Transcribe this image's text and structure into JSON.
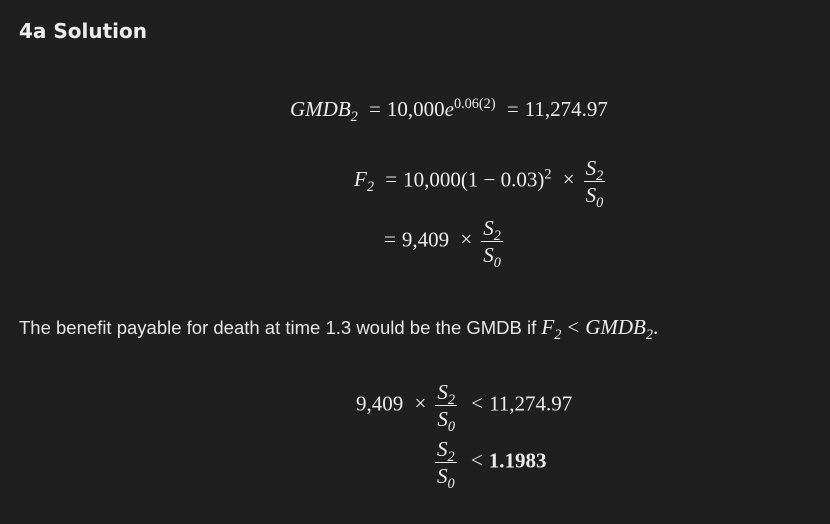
{
  "heading": "4a Solution",
  "equations": {
    "gmdb": {
      "lhs_base": "GMDB",
      "lhs_sub": "2",
      "eq": "=",
      "coef": "10,000",
      "e": "e",
      "exp": "0.06(2)",
      "eq2": "=",
      "result": "11,274.97"
    },
    "f2_line1": {
      "lhs_base": "F",
      "lhs_sub": "2",
      "eq": "=",
      "expr": "10,000(1 − 0.03)",
      "exp": "2",
      "times": "×",
      "frac_num_base": "S",
      "frac_num_sub": "2",
      "frac_den_base": "S",
      "frac_den_sub": "0"
    },
    "f2_line2": {
      "eq": "=",
      "coef": "9,409",
      "times": "×",
      "frac_num_base": "S",
      "frac_num_sub": "2",
      "frac_den_base": "S",
      "frac_den_sub": "0"
    }
  },
  "paragraph": {
    "text": "The benefit payable for death at time 1.3 would be the GMDB if ",
    "math_f": "F",
    "math_f_sub": "2",
    "lt": "<",
    "math_gmdb": "GMDB",
    "math_gmdb_sub": "2",
    "period": "."
  },
  "inequalities": {
    "line1": {
      "coef": "9,409",
      "times": "×",
      "frac_num_base": "S",
      "frac_num_sub": "2",
      "frac_den_base": "S",
      "frac_den_sub": "0",
      "lt": "<",
      "rhs": "11,274.97"
    },
    "line2": {
      "frac_num_base": "S",
      "frac_num_sub": "2",
      "frac_den_base": "S",
      "frac_den_sub": "0",
      "lt": "<",
      "rhs": "1.1983"
    }
  }
}
